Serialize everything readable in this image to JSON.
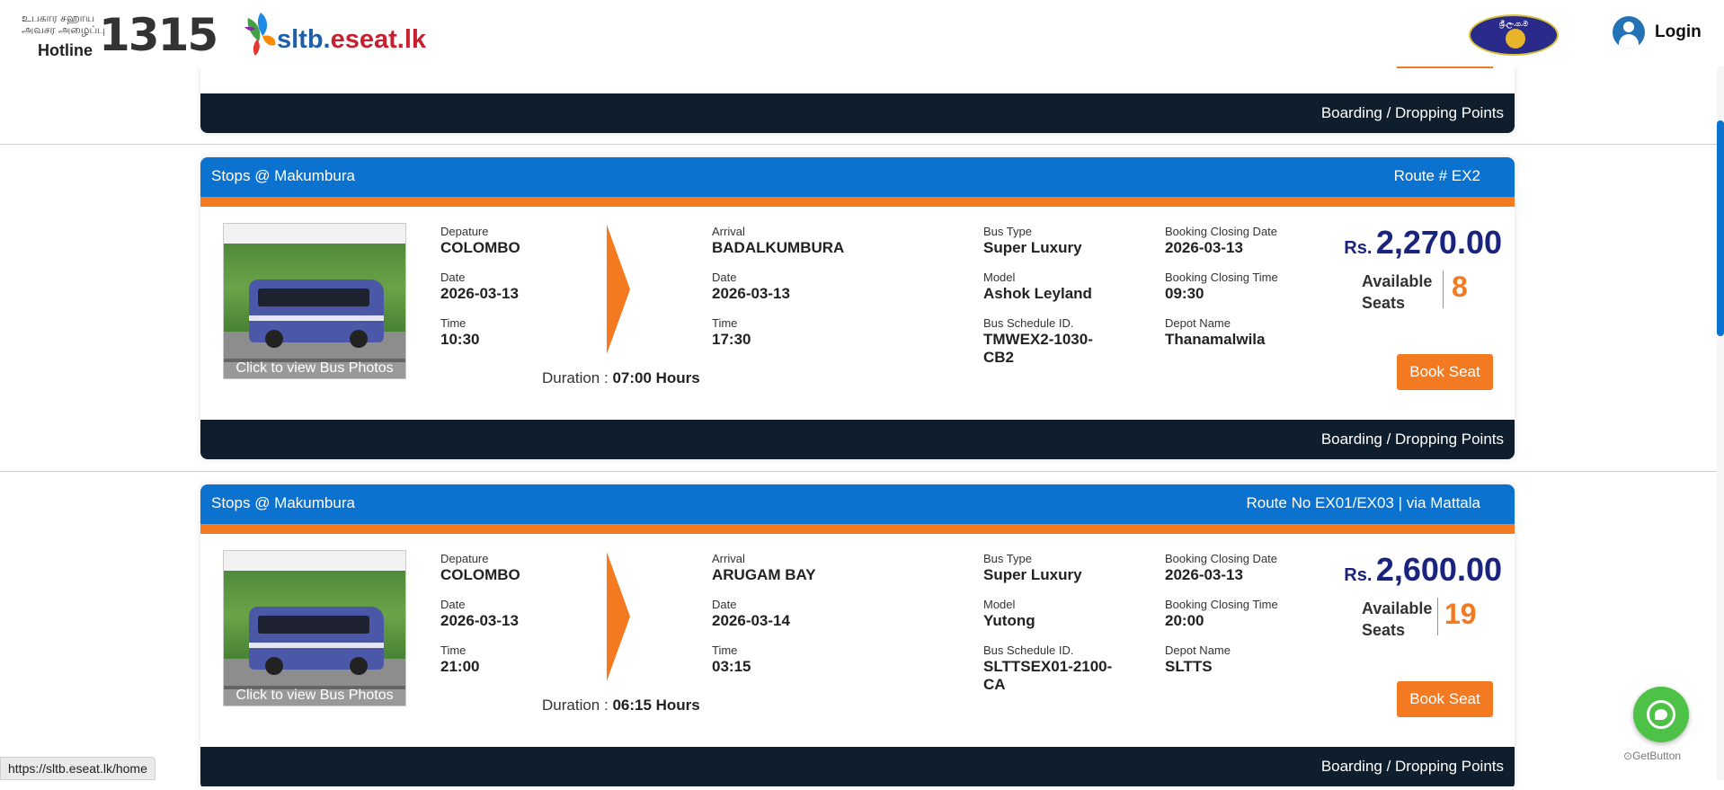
{
  "header": {
    "hotline_small_1": "உபகார சஹாய",
    "hotline_small_2": "அவசர அழைப்பு",
    "hotline_label": "Hotline",
    "hotline_number": "1315",
    "brand_part1": "sltb.",
    "brand_part2": "eseat.lk",
    "seal_text": "ශ්‍රී.ලං.ග.ම",
    "login_label": "Login"
  },
  "partial_card": {
    "boarding_label": "Boarding / Dropping Points"
  },
  "cards": [
    {
      "stops": "Stops @ Makumbura",
      "route": "Route # EX2",
      "photo_caption": "Click to view Bus Photos",
      "departure_label": "Depature",
      "departure": "COLOMBO",
      "dep_date_label": "Date",
      "dep_date": "2026-03-13",
      "dep_time_label": "Time",
      "dep_time": "10:30",
      "arrival_label": "Arrival",
      "arrival": "BADALKUMBURA",
      "arr_date_label": "Date",
      "arr_date": "2026-03-13",
      "arr_time_label": "Time",
      "arr_time": "17:30",
      "duration_label": "Duration :",
      "duration": "07:00 Hours",
      "bus_type_label": "Bus Type",
      "bus_type": "Super Luxury",
      "model_label": "Model",
      "model": "Ashok Leyland",
      "schedule_label": "Bus Schedule ID.",
      "schedule_line1": "TMWEX2-1030-",
      "schedule_line2": "CB2",
      "closing_date_label": "Booking Closing Date",
      "closing_date": "2026-03-13",
      "closing_time_label": "Booking Closing Time",
      "closing_time": "09:30",
      "depot_label": "Depot Name",
      "depot": "Thanamalwila",
      "currency": "Rs.",
      "price": "2,270.00",
      "seats_label_1": "Available",
      "seats_label_2": "Seats",
      "seats": "8",
      "book_label": "Book Seat",
      "boarding_label": "Boarding / Dropping Points"
    },
    {
      "stops": "Stops @ Makumbura",
      "route": "Route No EX01/EX03 | via Mattala",
      "photo_caption": "Click to view Bus Photos",
      "departure_label": "Depature",
      "departure": "COLOMBO",
      "dep_date_label": "Date",
      "dep_date": "2026-03-13",
      "dep_time_label": "Time",
      "dep_time": "21:00",
      "arrival_label": "Arrival",
      "arrival": "ARUGAM BAY",
      "arr_date_label": "Date",
      "arr_date": "2026-03-14",
      "arr_time_label": "Time",
      "arr_time": "03:15",
      "duration_label": "Duration :",
      "duration": "06:15 Hours",
      "bus_type_label": "Bus Type",
      "bus_type": "Super Luxury",
      "model_label": "Model",
      "model": "Yutong",
      "schedule_label": "Bus Schedule ID.",
      "schedule_line1": "SLTTSEX01-2100-",
      "schedule_line2": "CA",
      "closing_date_label": "Booking Closing Date",
      "closing_date": "2026-03-13",
      "closing_time_label": "Booking Closing Time",
      "closing_time": "20:00",
      "depot_label": "Depot Name",
      "depot": "SLTTS",
      "currency": "Rs.",
      "price": "2,600.00",
      "seats_label_1": "Available",
      "seats_label_2": "Seats",
      "seats": "19",
      "book_label": "Book Seat",
      "boarding_label": "Boarding / Dropping Points"
    }
  ],
  "floating": {
    "getbutton_label": "GetButton",
    "status_url": "https://sltb.eseat.lk/home"
  },
  "colors": {
    "primary_blue": "#0b72cf",
    "accent_orange": "#f47a21",
    "dark_navy": "#0f1e2d",
    "price_navy": "#1a237e",
    "whatsapp_green": "#4dc247"
  }
}
